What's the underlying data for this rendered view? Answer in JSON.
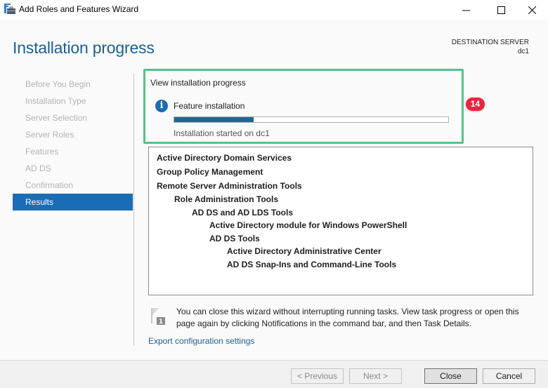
{
  "window": {
    "title": "Add Roles and Features Wizard",
    "icon": "server-manager-toolbox-icon",
    "controls": [
      "minimize",
      "maximize",
      "close"
    ]
  },
  "header": {
    "page_title": "Installation progress",
    "destination_label": "DESTINATION SERVER",
    "destination_value": "dc1"
  },
  "sidebar": {
    "items": [
      {
        "label": "Before You Begin",
        "active": false
      },
      {
        "label": "Installation Type",
        "active": false
      },
      {
        "label": "Server Selection",
        "active": false
      },
      {
        "label": "Server Roles",
        "active": false
      },
      {
        "label": "Features",
        "active": false
      },
      {
        "label": "AD DS",
        "active": false
      },
      {
        "label": "Confirmation",
        "active": false
      },
      {
        "label": "Results",
        "active": true
      }
    ]
  },
  "progress": {
    "section_label": "View installation progress",
    "status_icon": "info-icon",
    "task_label": "Feature installation",
    "percent": 29,
    "status_text": "Installation started on dc1",
    "annotation_badge": "14",
    "colors": {
      "fill": "#1b6a8c",
      "highlight": "#5ac08a",
      "badge": "#e8263f"
    }
  },
  "results": {
    "items": [
      {
        "label": "Active Directory Domain Services",
        "level": 0
      },
      {
        "label": "Group Policy Management",
        "level": 0
      },
      {
        "label": "Remote Server Administration Tools",
        "level": 0
      },
      {
        "label": "Role Administration Tools",
        "level": 1
      },
      {
        "label": "AD DS and AD LDS Tools",
        "level": 2
      },
      {
        "label": "Active Directory module for Windows PowerShell",
        "level": 3
      },
      {
        "label": "AD DS Tools",
        "level": 3
      },
      {
        "label": "Active Directory Administrative Center",
        "level": 4
      },
      {
        "label": "AD DS Snap-Ins and Command-Line Tools",
        "level": 4
      }
    ]
  },
  "notice": {
    "icon": "notification-flag-icon",
    "text": "You can close this wizard without interrupting running tasks. View task progress or open this page again by clicking Notifications in the command bar, and then Task Details."
  },
  "export_link": "Export configuration settings",
  "footer": {
    "previous_label": "< Previous",
    "next_label": "Next >",
    "close_label": "Close",
    "cancel_label": "Cancel"
  }
}
